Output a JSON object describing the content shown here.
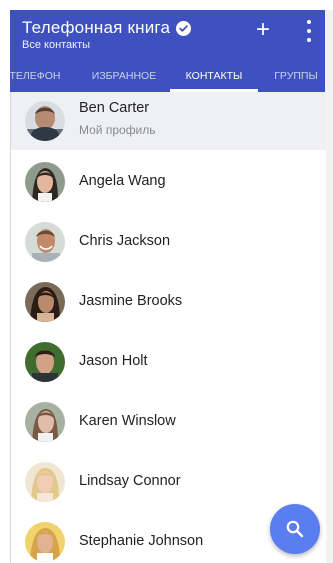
{
  "header": {
    "title": "Телефонная книга",
    "subtitle": "Все контакты",
    "add_label": "+",
    "background": "#3f51c0"
  },
  "tabs": [
    {
      "label": "ТЕЛЕФОН",
      "active": false
    },
    {
      "label": "ИЗБРАННОЕ",
      "active": false
    },
    {
      "label": "КОНТАКТЫ",
      "active": true
    },
    {
      "label": "ГРУППЫ",
      "active": false
    }
  ],
  "profile": {
    "name": "Ben Carter",
    "subtitle": "Мой профиль"
  },
  "contacts": [
    {
      "name": "Angela Wang"
    },
    {
      "name": "Chris Jackson"
    },
    {
      "name": "Jasmine Brooks"
    },
    {
      "name": "Jason Holt"
    },
    {
      "name": "Karen Winslow"
    },
    {
      "name": "Lindsay Connor"
    },
    {
      "name": "Stephanie Johnson"
    }
  ],
  "icons": {
    "verified": "check-circle-icon",
    "add": "plus-icon",
    "more": "more-vertical-icon",
    "search": "search-icon"
  },
  "colors": {
    "accent": "#3f51c0",
    "fab": "#5a7df0",
    "profile_background": "#eef0f4"
  }
}
